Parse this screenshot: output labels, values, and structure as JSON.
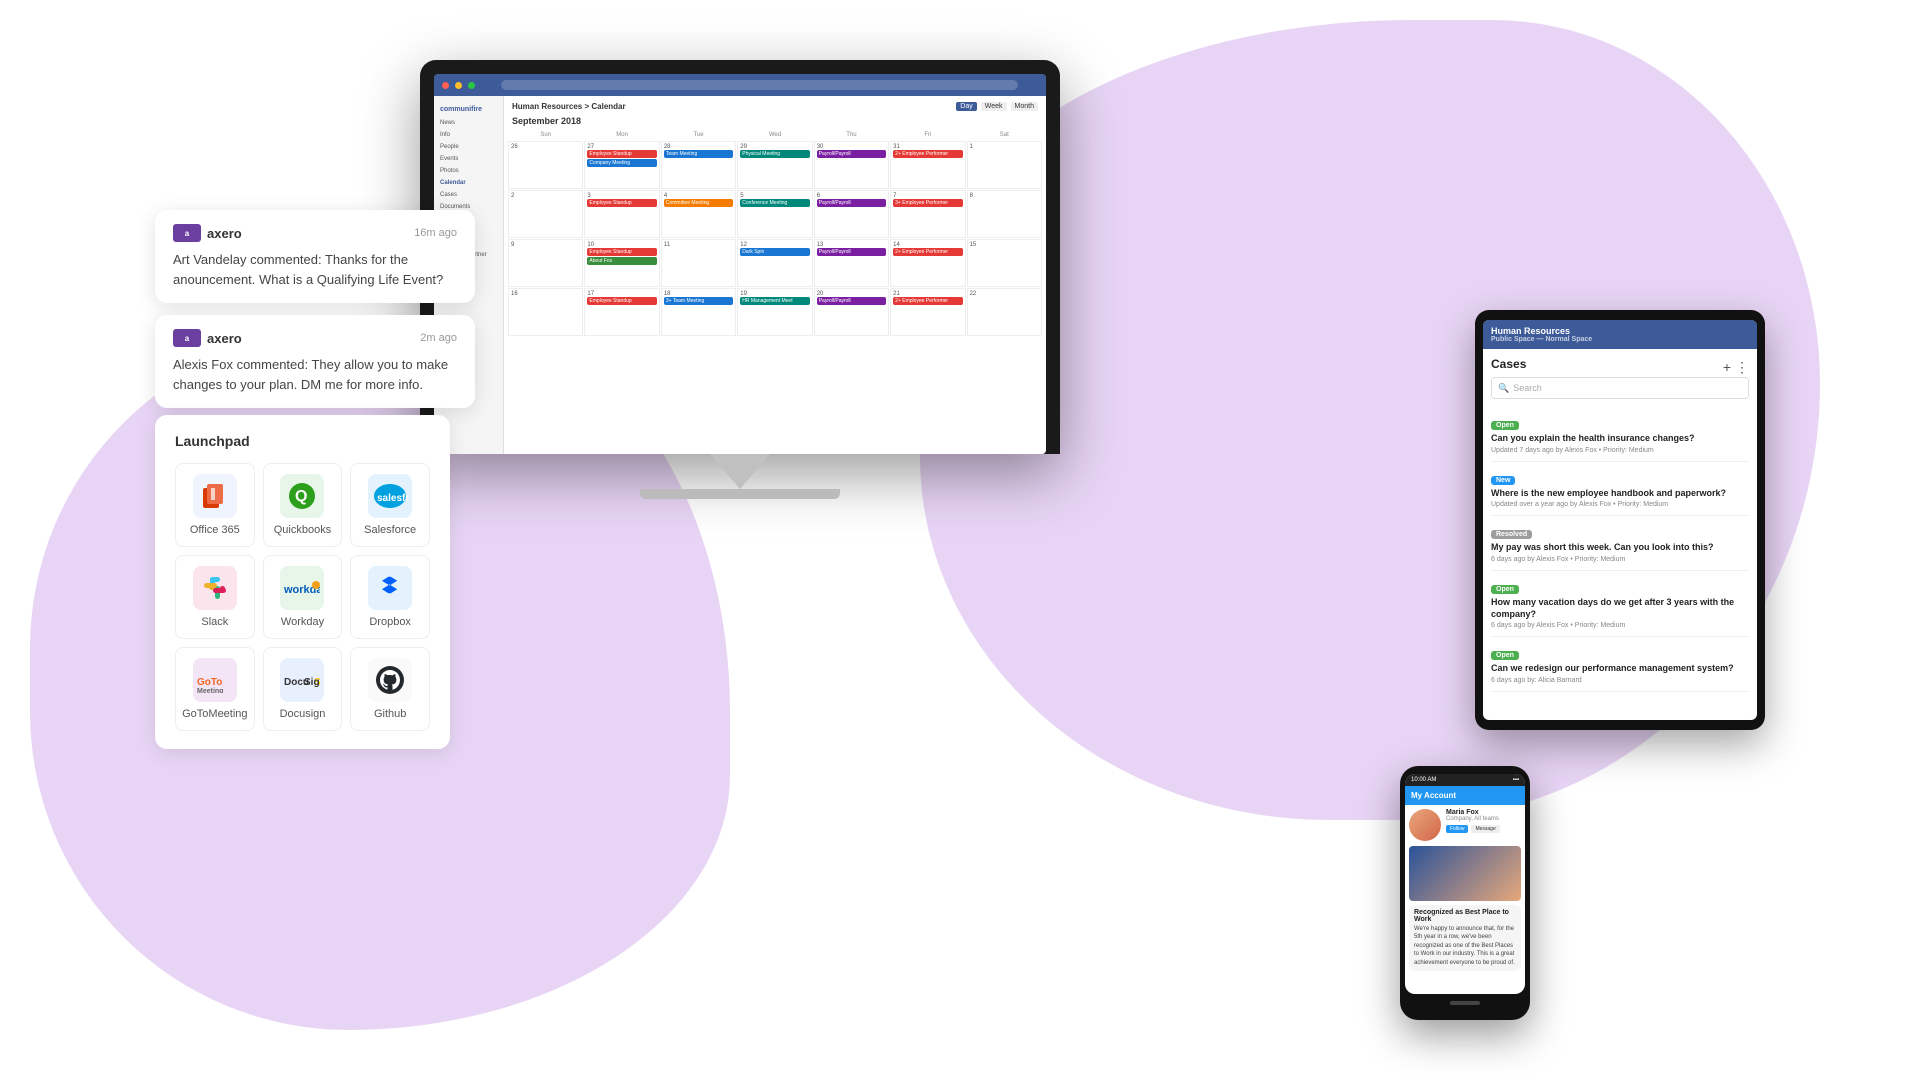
{
  "background": {
    "blob_color": "#e8d5f5"
  },
  "notifications": [
    {
      "brand": "axero",
      "time": "16m ago",
      "text": "Art Vandelay commented: Thanks for the anouncement. What is a Qualifying Life Event?"
    },
    {
      "brand": "axero",
      "time": "2m ago",
      "text": "Alexis Fox commented: They allow you to make changes to your plan. DM me for more info."
    }
  ],
  "launchpad": {
    "title": "Launchpad",
    "apps": [
      {
        "name": "Office 365",
        "key": "office365"
      },
      {
        "name": "Quickbooks",
        "key": "quickbooks"
      },
      {
        "name": "Salesforce",
        "key": "salesforce"
      },
      {
        "name": "Slack",
        "key": "slack"
      },
      {
        "name": "Workday",
        "key": "workday"
      },
      {
        "name": "Dropbox",
        "key": "dropbox"
      },
      {
        "name": "GoToMeeting",
        "key": "gotomeeting"
      },
      {
        "name": "Docusign",
        "key": "docusign"
      },
      {
        "name": "Github",
        "key": "github"
      }
    ]
  },
  "monitor": {
    "calendar": {
      "title": "Human Resources - Calendar",
      "month": "September 2018",
      "days": [
        "Sun",
        "Mon",
        "Tue",
        "Wed",
        "Thu",
        "Fri",
        "Sat"
      ]
    }
  },
  "tablet": {
    "header": "Human Resources",
    "section": "Cases",
    "search_placeholder": "Search",
    "cases": [
      {
        "badge": "Open",
        "badge_type": "open",
        "question": "Can you explain the health insurance changes?",
        "meta": "Updated 7 days ago by Alexis Fox • Priority: Medium"
      },
      {
        "badge": "New",
        "badge_type": "new",
        "question": "Where is the new employee handbook and paperwork?",
        "meta": "Updated over a year ago by Alexis Fox • Priority: Medium"
      },
      {
        "badge": "Resolved",
        "badge_type": "resolved",
        "question": "My pay was short this week. Can you look into this?",
        "meta": "6 days ago by Alexis Fox • Priority: Medium"
      },
      {
        "badge": "Open",
        "badge_type": "open",
        "question": "How many vacation days do we get after 3 years with the company?",
        "meta": "6 days ago by Alexis Fox • Priority: Medium"
      },
      {
        "badge": "Open",
        "badge_type": "open",
        "question": "Can we redesign our performance management system?",
        "meta": "6 days ago by: Alicia Barnard"
      }
    ]
  },
  "phone": {
    "status": "10:00 AM",
    "header": "My Account",
    "post_text": "Recognized as Best Place to Work",
    "post_body": "We're happy to announce that, for the 5th year in a row, we've been recognized as one of the Best Places to Work in our industry. This is a great achievement everyone to be proud of."
  }
}
